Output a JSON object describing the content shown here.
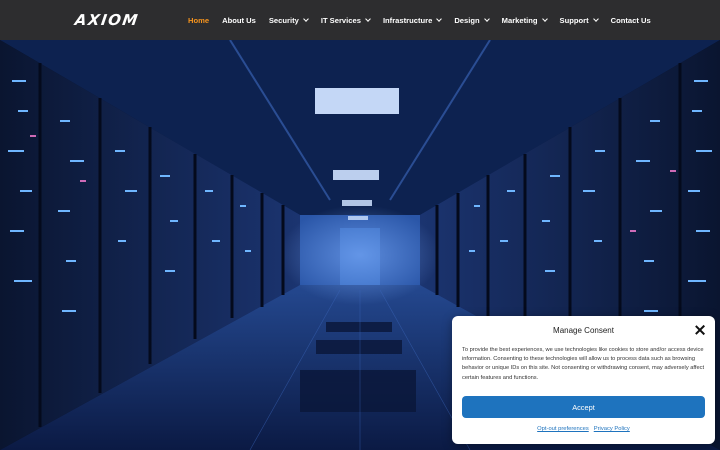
{
  "brand": {
    "logo_text": "AXIOM"
  },
  "nav": {
    "items": [
      {
        "label": "Home",
        "active": true,
        "dropdown": false
      },
      {
        "label": "About Us",
        "active": false,
        "dropdown": false
      },
      {
        "label": "Security",
        "active": false,
        "dropdown": true
      },
      {
        "label": "IT Services",
        "active": false,
        "dropdown": true
      },
      {
        "label": "Infrastructure",
        "active": false,
        "dropdown": true
      },
      {
        "label": "Design",
        "active": false,
        "dropdown": true
      },
      {
        "label": "Marketing",
        "active": false,
        "dropdown": true
      },
      {
        "label": "Support",
        "active": false,
        "dropdown": true
      },
      {
        "label": "Contact Us",
        "active": false,
        "dropdown": false
      }
    ]
  },
  "consent": {
    "title": "Manage Consent",
    "text": "To provide the best experiences, we use technologies like cookies to store and/or access device information. Consenting to these technologies will allow us to process data such as browsing behavior or unique IDs on this site. Not consenting or withdrawing consent, may adversely affect certain features and functions.",
    "accept_label": "Accept",
    "optout_label": "Opt-out preferences",
    "privacy_label": "Privacy Policy"
  },
  "colors": {
    "nav_bg": "#2d2d2f",
    "active": "#f7941d",
    "accent": "#1e73be"
  }
}
